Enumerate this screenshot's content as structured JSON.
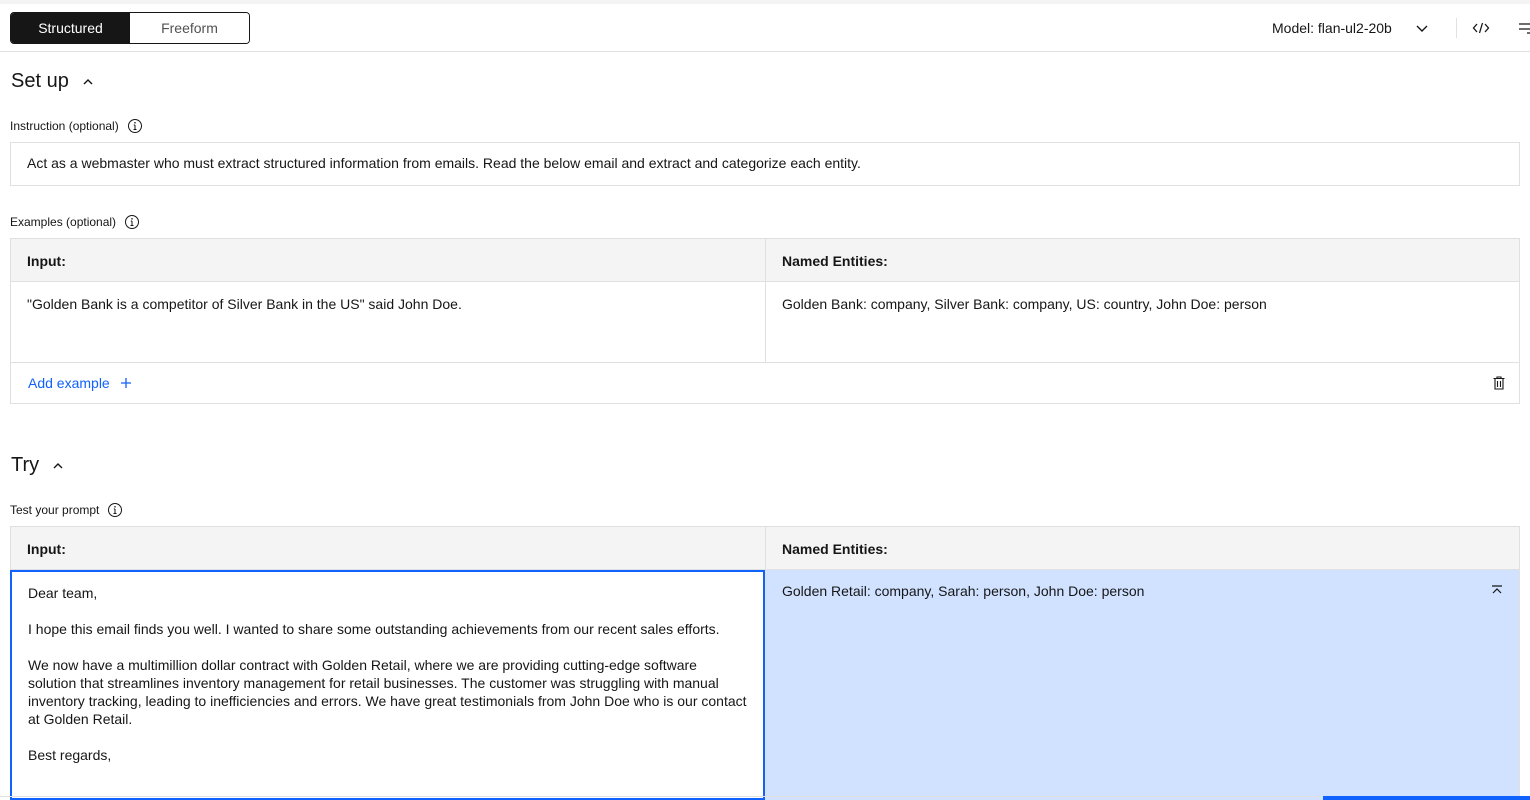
{
  "header": {
    "tabs": [
      {
        "label": "Structured",
        "active": true
      },
      {
        "label": "Freeform",
        "active": false
      }
    ],
    "model_label": "Model: flan-ul2-20b",
    "icons": [
      "chevron-down-icon",
      "code-icon",
      "settings-adjust-icon"
    ]
  },
  "setup": {
    "title": "Set up",
    "instruction_label": "Instruction (optional)",
    "instruction_text": "Act as a webmaster who must extract structured information from emails. Read the below email and extract and categorize each entity.",
    "examples_label": "Examples (optional)",
    "examples": {
      "columns": [
        "Input:",
        "Named Entities:"
      ],
      "rows": [
        [
          "\"Golden Bank is a competitor of Silver Bank in the US\" said John Doe.",
          "Golden Bank: company, Silver Bank: company, US: country, John Doe: person"
        ]
      ],
      "add_label": "Add example"
    }
  },
  "try": {
    "title": "Try",
    "test_label": "Test your prompt",
    "columns": [
      "Input:",
      "Named Entities:"
    ],
    "input_text": "Dear team,\n\nI hope this email finds you well. I wanted to share some outstanding achievements from our recent sales efforts.\n\nWe now have a multimillion dollar contract with Golden Retail, where we are providing cutting-edge software solution that streamlines inventory management for retail businesses. The customer was struggling with manual inventory tracking, leading to inefficiencies and errors. We have great testimonials from John Doe who is our contact at Golden Retail.\n\nBest regards,",
    "output_text": "Golden Retail: company, Sarah: person, John Doe: person"
  },
  "colors": {
    "accent": "#0f62fe",
    "output_bg": "#d0e2ff",
    "header_bg": "#f4f4f4",
    "border": "#e0e0e0",
    "text": "#161616"
  }
}
